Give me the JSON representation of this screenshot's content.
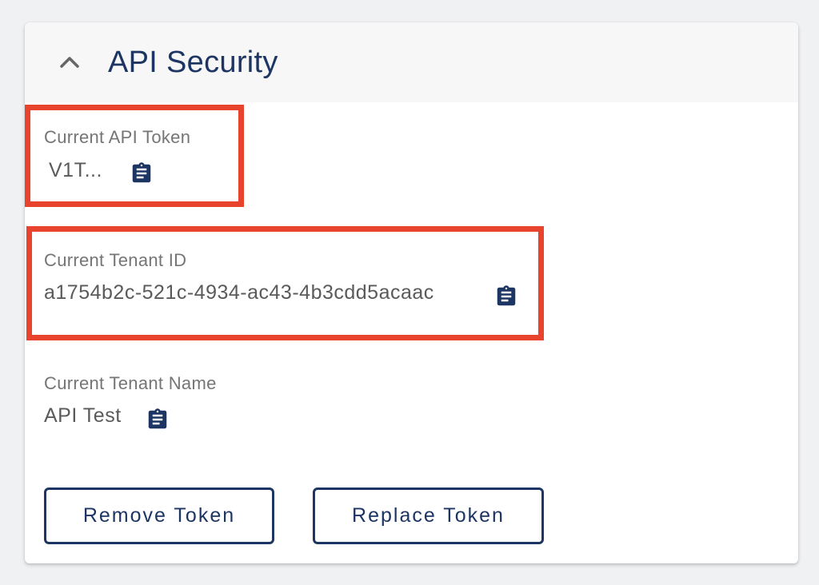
{
  "header": {
    "title": "API Security",
    "collapse_icon": "chevron-up-icon"
  },
  "fields": {
    "api_token": {
      "label": "Current API Token",
      "value": "V1T...",
      "copy_icon": "clipboard-icon"
    },
    "tenant_id": {
      "label": "Current Tenant ID",
      "value": "a1754b2c-521c-4934-ac43-4b3cdd5acaac",
      "copy_icon": "clipboard-icon"
    },
    "tenant_name": {
      "label": "Current Tenant Name",
      "value": "API Test",
      "copy_icon": "clipboard-icon"
    }
  },
  "actions": {
    "remove_label": "Remove Token",
    "replace_label": "Replace Token"
  },
  "colors": {
    "accent": "#1d3563",
    "highlight": "#e8432d",
    "label": "#757575",
    "value": "#5a5a5a",
    "header_bg": "#f7f7f7"
  }
}
